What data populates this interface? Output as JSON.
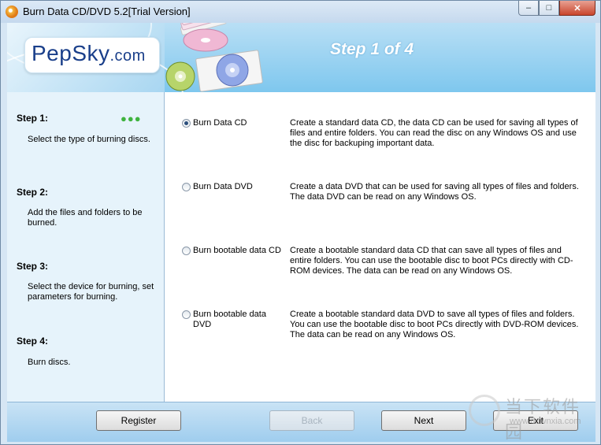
{
  "window": {
    "title": "Burn Data CD/DVD 5.2[Trial Version]",
    "controls": {
      "minimize": "–",
      "maximize": "□",
      "close": "✕"
    }
  },
  "header": {
    "logo_main": "PepSky",
    "logo_domain": ".com",
    "step_heading": "Step 1 of 4"
  },
  "sidebar": {
    "steps": [
      {
        "title": "Step 1:",
        "desc": "Select the type of burning discs."
      },
      {
        "title": "Step 2:",
        "desc": "Add the files and folders to be burned."
      },
      {
        "title": "Step 3:",
        "desc": "Select the device for burning, set parameters for burning."
      },
      {
        "title": "Step 4:",
        "desc": "Burn discs."
      }
    ],
    "current_indicator": "●●●"
  },
  "options": [
    {
      "label": "Burn Data CD",
      "checked": true,
      "desc": "Create a standard data CD, the data CD can be used for saving all types of files and entire folders. You can read the disc on any Windows OS and use the disc for backuping important data."
    },
    {
      "label": "Burn Data DVD",
      "checked": false,
      "desc": "Create a data DVD that can be used for saving all types of files and folders. The data DVD can be read on any Windows OS."
    },
    {
      "label": "Burn bootable data CD",
      "checked": false,
      "desc": "Create a bootable standard data CD that can save all types of files and entire folders. You can use the bootable disc to boot PCs directly with CD-ROM devices. The data can be read on any Windows OS."
    },
    {
      "label": "Burn bootable data DVD",
      "checked": false,
      "desc": "Create a bootable standard data DVD to save all types of files and folders. You can use the bootable disc to boot PCs directly with DVD-ROM devices. The data can be read on any Windows OS."
    }
  ],
  "footer": {
    "register": "Register",
    "back": "Back",
    "next": "Next",
    "exit": "Exit"
  },
  "watermark": {
    "text": "当下软件园",
    "url": "www.downxia.com"
  },
  "colors": {
    "header_gradient": "#7ec7ee",
    "sidebar_bg": "#e6f3fb",
    "step_heading": "#ffffff",
    "current_indicator": "#3fb33f",
    "logo_text": "#1a3f8a"
  }
}
